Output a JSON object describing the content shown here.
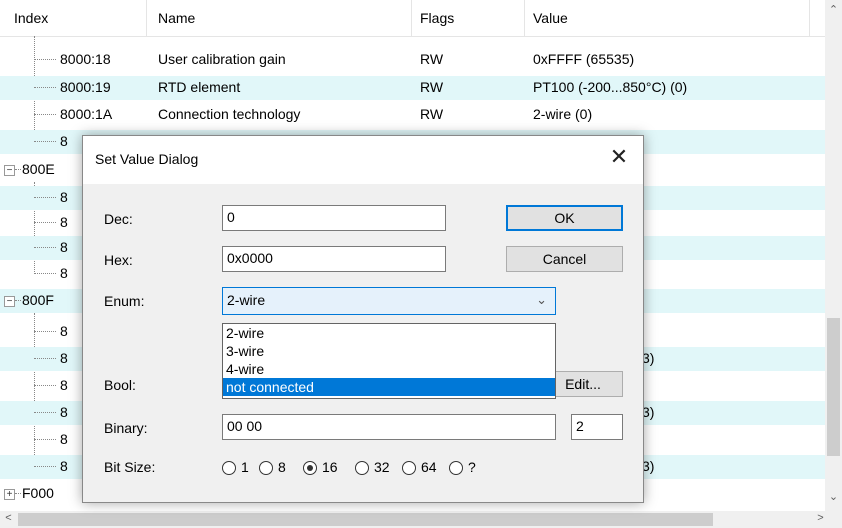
{
  "list": {
    "headers": {
      "index": "Index",
      "name": "Name",
      "flags": "Flags",
      "value": "Value"
    },
    "rows": [
      {
        "index": "8000:18",
        "name": "User calibration gain",
        "flags": "RW",
        "value": "0xFFFF (65535)"
      },
      {
        "index": "8000:19",
        "name": "RTD element",
        "flags": "RW",
        "value": "PT100 (-200...850°C) (0)"
      },
      {
        "index": "8000:1A",
        "name": "Connection technology",
        "flags": "RW",
        "value": "2-wire (0)"
      }
    ],
    "partial": {
      "row4": "8",
      "group1": "800E",
      "sub1": "8",
      "sub2": "8",
      "sub3": "8",
      "sub4": "8",
      "group2": "800F",
      "sub5": "8",
      "sub6": "8",
      "sub7": "8",
      "sub8": "8",
      "sub9": "8",
      "sub10": "8",
      "group3": "F000",
      "val1": "3)",
      "val2": "3)",
      "val3": "3)"
    },
    "expander_collapse": "−",
    "expander_expand": "+"
  },
  "dialog": {
    "title": "Set Value Dialog",
    "close_glyph": "✕",
    "dec_label": "Dec:",
    "dec_value": "0",
    "hex_label": "Hex:",
    "hex_value": "0x0000",
    "enum_label": "Enum:",
    "enum_value": "2-wire",
    "enum_options": [
      "2-wire",
      "3-wire",
      "4-wire",
      "not connected"
    ],
    "bool_label": "Bool:",
    "binary_label": "Binary:",
    "binary_value": "00 00",
    "binary_count": "2",
    "bitsize_label": "Bit Size:",
    "bitsize_options": [
      "1",
      "8",
      "16",
      "32",
      "64",
      "?"
    ],
    "bitsize_selected": "16",
    "ok_label": "OK",
    "cancel_label": "Cancel",
    "edit_label": "Edit..."
  },
  "colors": {
    "stripe": "#e1f7f9",
    "accent": "#0078d7",
    "dialog_bg": "#f0f0f0"
  },
  "icons": {
    "scroll_up": "chevron-up-icon",
    "scroll_down": "chevron-down-icon",
    "scroll_left": "chevron-left-icon",
    "scroll_right": "chevron-right-icon"
  }
}
